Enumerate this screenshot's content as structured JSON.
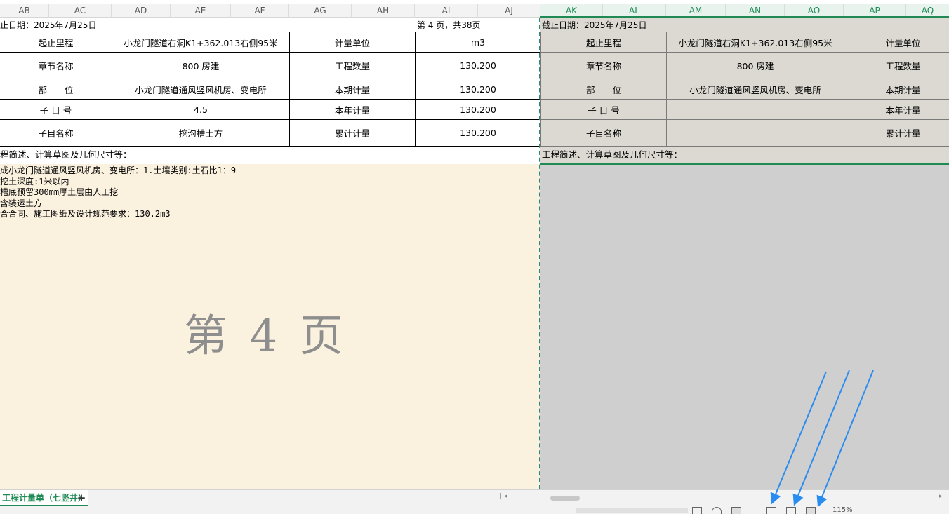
{
  "columns": [
    {
      "id": "AB",
      "selected": false
    },
    {
      "id": "AC",
      "selected": false
    },
    {
      "id": "AD",
      "selected": false
    },
    {
      "id": "AE",
      "selected": false
    },
    {
      "id": "AF",
      "selected": false
    },
    {
      "id": "AG",
      "selected": false
    },
    {
      "id": "AH",
      "selected": false
    },
    {
      "id": "AI",
      "selected": false
    },
    {
      "id": "AJ",
      "selected": false
    },
    {
      "id": "AK",
      "selected": true
    },
    {
      "id": "AL",
      "selected": true
    },
    {
      "id": "AM",
      "selected": true
    },
    {
      "id": "AN",
      "selected": true
    },
    {
      "id": "AO",
      "selected": true
    },
    {
      "id": "AP",
      "selected": true
    },
    {
      "id": "AQ",
      "selected": true
    }
  ],
  "left_page": {
    "date_line": "止日期：2025年7月25日",
    "page_info": "第 4 页，共38页",
    "rows": [
      [
        "起止里程",
        "小龙门隧道右洞K1+362.013右侧95米",
        "计量单位",
        "m3"
      ],
      [
        "章节名称",
        "800 房建",
        "工程数量",
        "130.200"
      ],
      [
        "部　　位",
        "小龙门隧道通风竖风机房、变电所",
        "本期计量",
        "130.200"
      ],
      [
        "子 目 号",
        "4.5",
        "本年计量",
        "130.200"
      ],
      [
        "子目名称",
        "挖沟槽土方",
        "累计计量",
        "130.200"
      ]
    ],
    "desc_label": "程简述、计算草图及几何尺寸等：",
    "desc_lines": [
      "成小龙门隧道通风竖风机房、变电所：1.土壤类别:土石比1：9",
      "挖土深度:1米以内",
      "槽底预留300mm厚土层由人工挖",
      "含装运土方",
      "合合同、施工图纸及设计规范要求：130.2m3"
    ],
    "watermark": "第 4 页"
  },
  "right_page": {
    "date_line": "截止日期：2025年7月25日",
    "rows": [
      [
        "起止里程",
        "小龙门隧道右洞K1+362.013右侧95米",
        "计量单位"
      ],
      [
        "章节名称",
        "800 房建",
        "工程数量"
      ],
      [
        "部　　位",
        "小龙门隧道通风竖风机房、变电所",
        "本期计量"
      ],
      [
        "子 目 号",
        "",
        "本年计量"
      ],
      [
        "子目名称",
        "",
        "累计计量"
      ]
    ],
    "desc_label": "工程简述、计算草图及几何尺寸等："
  },
  "tabbar": {
    "sheet_tab": "工程计量单（七竖井）",
    "add_tab": "+"
  },
  "statusbar": {
    "zoom": "115%"
  },
  "colors": {
    "accent_green": "#1f8a54",
    "page_body": "#fbf1df",
    "arrow_blue": "#2b8cf0"
  }
}
